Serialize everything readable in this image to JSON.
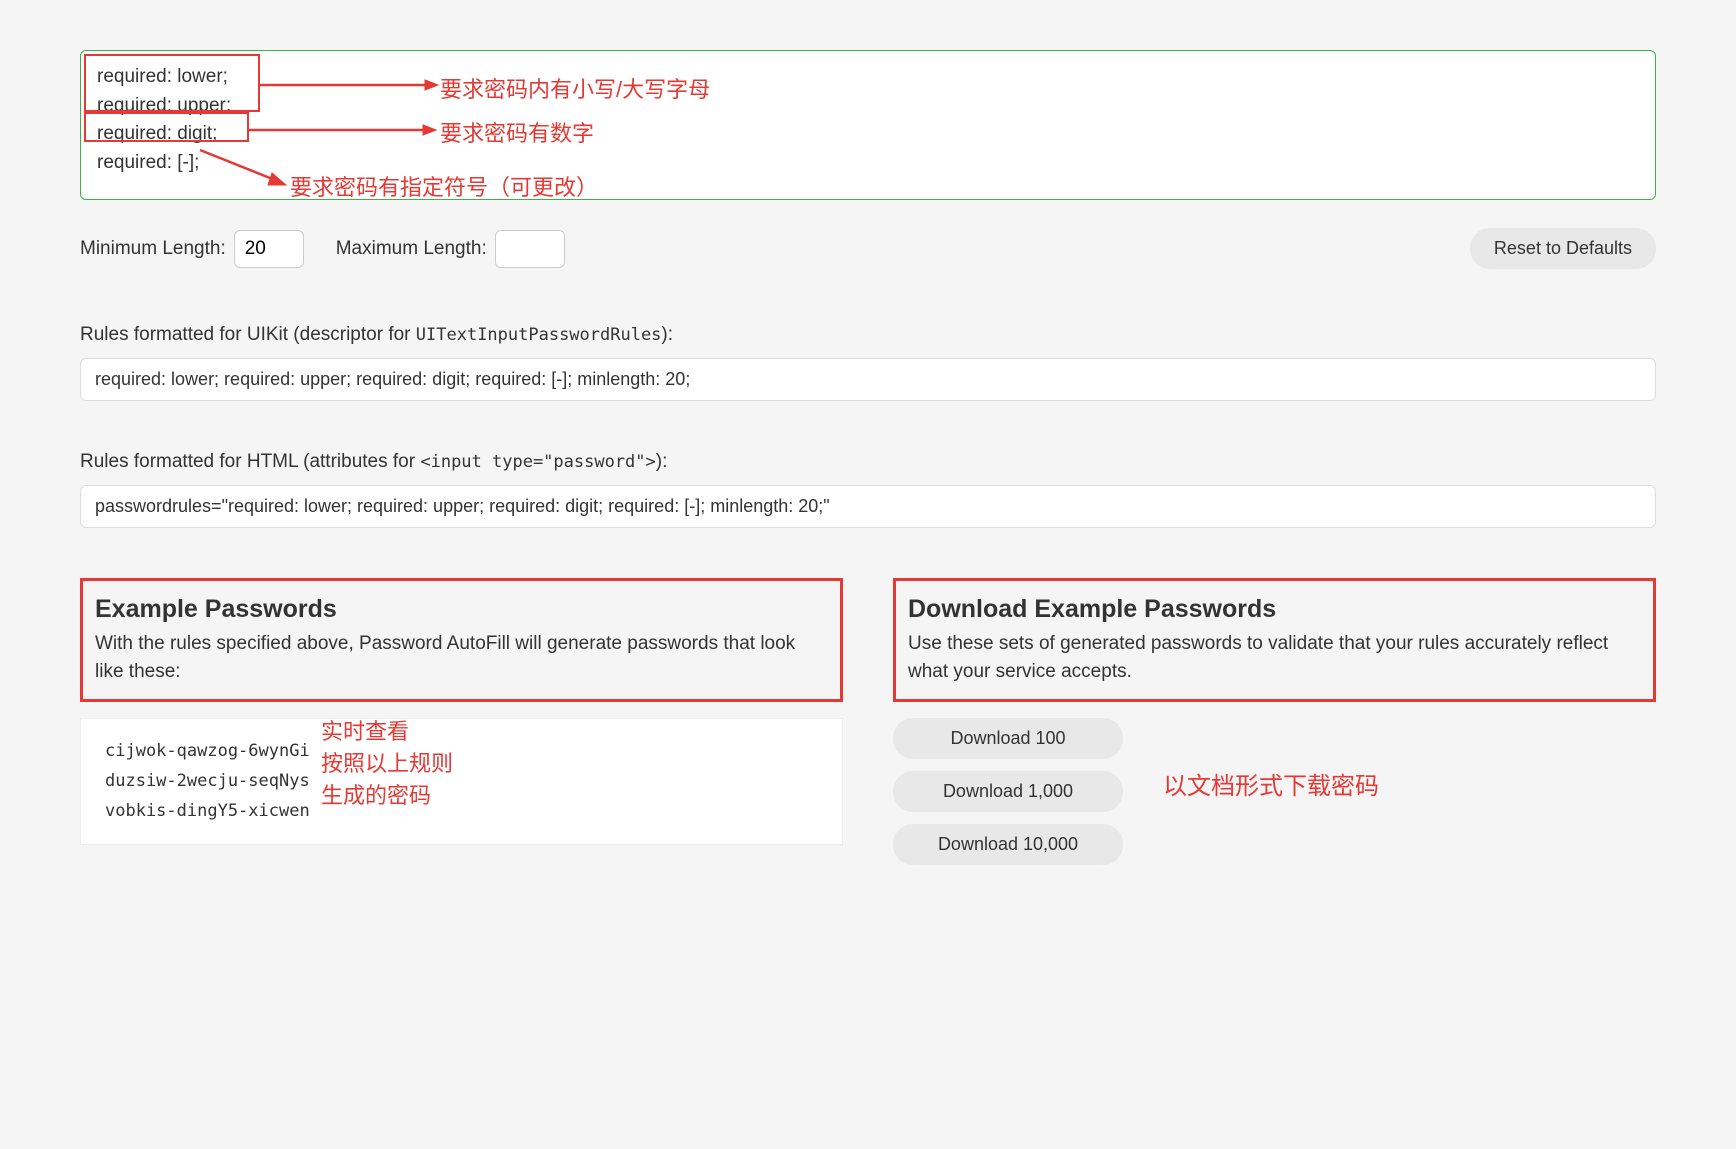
{
  "rulesInput": {
    "lines": [
      "required: lower;",
      "required: upper;",
      "required: digit;",
      "required: [-];"
    ]
  },
  "annotations": {
    "rules1": "要求密码内有小写/大写字母",
    "rules2": "要求密码有数字",
    "rules3": "要求密码有指定符号（可更改）",
    "examples": "实时查看\n按照以上规则\n生成的密码",
    "download": "以文档形式下载密码"
  },
  "length": {
    "minLabel": "Minimum Length:",
    "minValue": "20",
    "maxLabel": "Maximum Length:",
    "maxValue": ""
  },
  "resetButton": "Reset to Defaults",
  "uikit": {
    "labelPrefix": "Rules formatted for UIKit (descriptor for ",
    "labelCode": "UITextInputPasswordRules",
    "labelSuffix": "):",
    "value": "required: lower; required: upper; required: digit; required: [-]; minlength: 20;"
  },
  "html": {
    "labelPrefix": "Rules formatted for HTML (attributes for ",
    "labelCode": "<input type=\"password\">",
    "labelSuffix": "):",
    "value": "passwordrules=\"required: lower; required: upper; required: digit; required: [-]; minlength: 20;\""
  },
  "examples": {
    "title": "Example Passwords",
    "description": "With the rules specified above, Password AutoFill will generate passwords that look like these:",
    "list": [
      "cijwok-qawzog-6wynGi",
      "duzsiw-2wecju-seqNys",
      "vobkis-dingY5-xicwen"
    ]
  },
  "download": {
    "title": "Download Example Passwords",
    "description": "Use these sets of generated passwords to validate that your rules accurately reflect what your service accepts.",
    "buttons": [
      "Download 100",
      "Download 1,000",
      "Download 10,000"
    ]
  }
}
